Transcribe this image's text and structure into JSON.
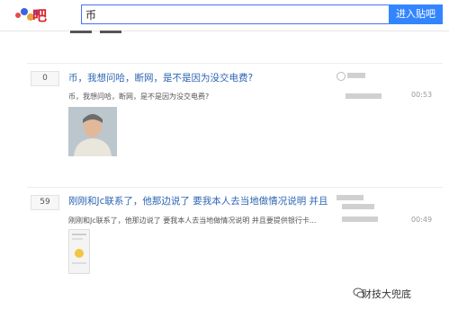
{
  "header": {
    "logo_text": "吧",
    "search_value": "币",
    "search_button": "进入贴吧"
  },
  "posts": [
    {
      "reply_count": "0",
      "title": "币，我想问哈，断网，是不是因为没交电费?",
      "excerpt": "币，我想问哈，断网，是不是因为没交电费?",
      "time": "00:53"
    },
    {
      "reply_count": "59",
      "title": "刚刚和Jc联系了，他那边说了 要我本人去当地做情况说明 并且",
      "excerpt": "刚刚和Jc联系了，他那边说了 要我本人去当地做情况说明 并且要提供银行卡...",
      "time": "00:49"
    }
  ],
  "watermark": "财技大兜底",
  "colors": {
    "search_button": "#3385ff",
    "link": "#2d64b3",
    "logo_red": "#d9232a"
  }
}
